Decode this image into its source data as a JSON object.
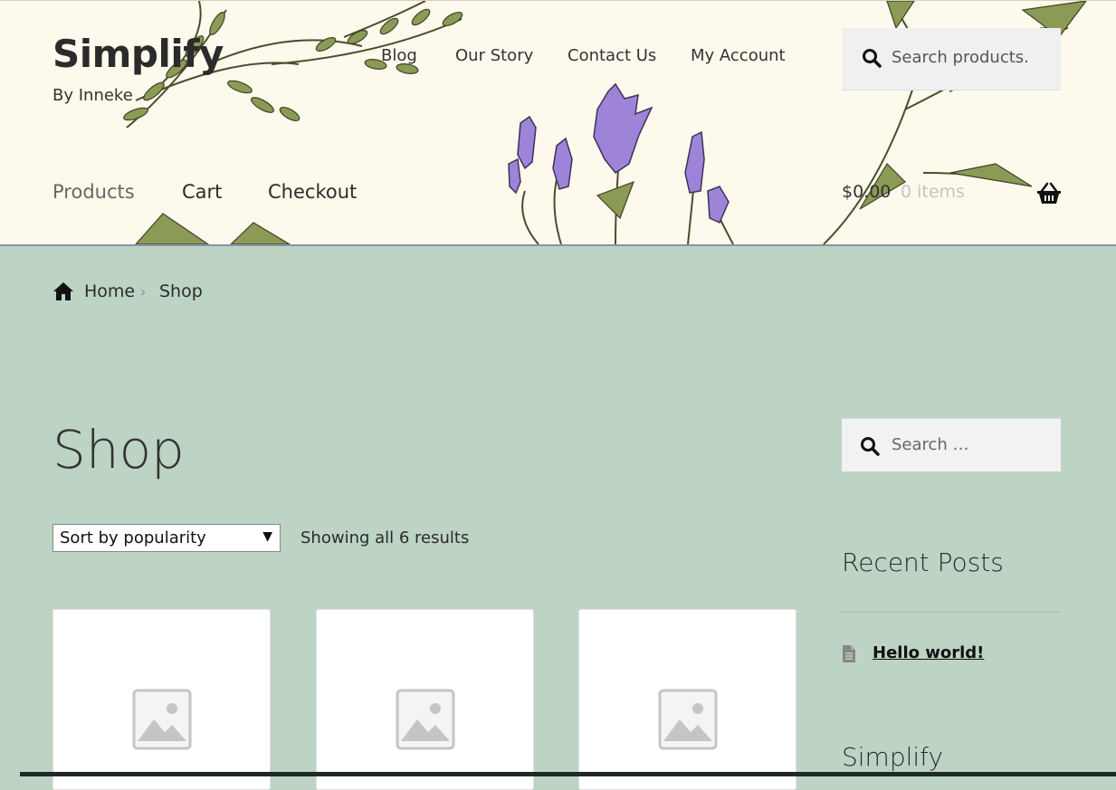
{
  "header": {
    "site_title": "Simplify",
    "tagline": "By Inneke",
    "nav": [
      "Blog",
      "Our Story",
      "Contact Us",
      "My Account"
    ],
    "search_placeholder": "Search products.",
    "secondary_nav": [
      "Products",
      "Cart",
      "Checkout"
    ],
    "cart_amount": "$0.00",
    "cart_count": "0 items"
  },
  "breadcrumb": {
    "home": "Home",
    "separator": "›",
    "current": "Shop"
  },
  "main": {
    "title": "Shop",
    "sort_selected": "Sort by popularity",
    "result_count": "Showing all 6 results"
  },
  "sidebar": {
    "search_placeholder": "Search …",
    "recent_posts_title": "Recent Posts",
    "recent_post": "Hello world!",
    "second_widget_title": "Simplify"
  },
  "colors": {
    "page_background": "#bdd3c3",
    "header_background": "#fdf9ec",
    "flower_purple": "#9d84d8",
    "leaf_green": "#8b9a55"
  },
  "icons": [
    "search-icon",
    "basket-icon",
    "home-icon",
    "chevron-right-icon",
    "placeholder-image-icon",
    "document-icon"
  ]
}
